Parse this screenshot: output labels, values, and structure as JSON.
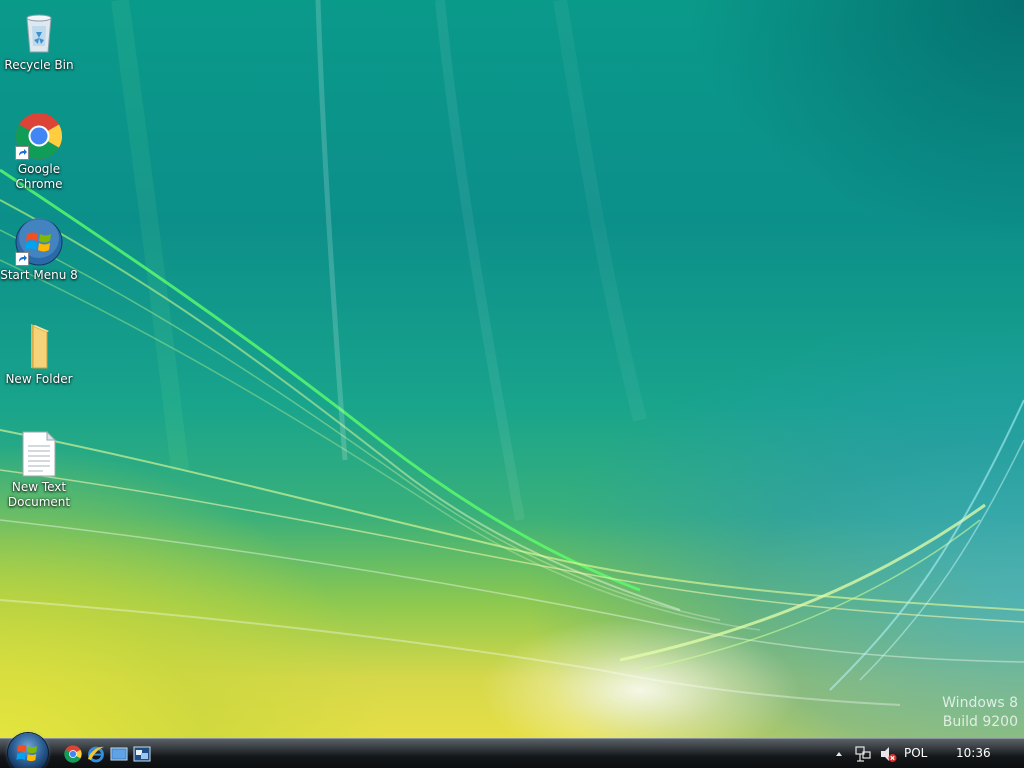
{
  "desktop": {
    "icons": [
      {
        "label": "Recycle Bin"
      },
      {
        "label": "Google Chrome"
      },
      {
        "label": "Start Menu 8"
      },
      {
        "label": "New Folder"
      },
      {
        "label": "New Text Document"
      }
    ],
    "watermark": {
      "line1": "Windows 8",
      "line2": "Build 9200"
    }
  },
  "taskbar": {
    "quick_launch": [
      "chrome-icon",
      "internet-explorer-icon",
      "show-desktop-icon",
      "switch-windows-icon"
    ],
    "tray": {
      "language": "POL",
      "clock": "10:36"
    }
  },
  "colors": {
    "taskbar": "#141719",
    "accent": "#2c5f96"
  }
}
